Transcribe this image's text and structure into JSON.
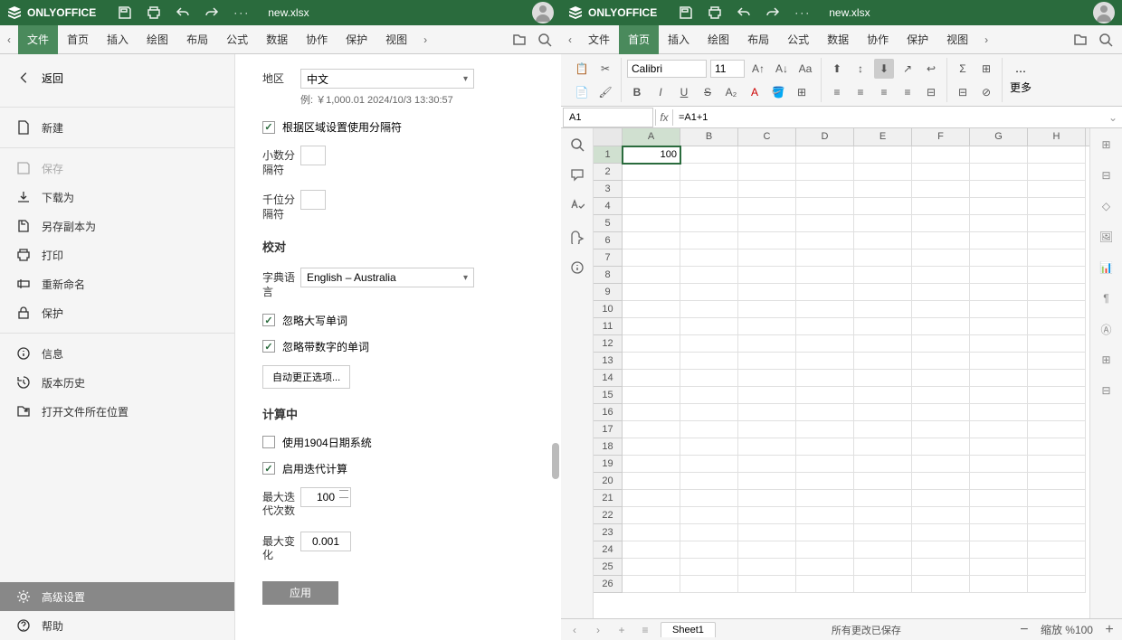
{
  "titlebar": {
    "logo": "ONLYOFFICE",
    "filename": "new.xlsx",
    "dots": "···"
  },
  "menus": [
    "文件",
    "首页",
    "插入",
    "绘图",
    "布局",
    "公式",
    "数据",
    "协作",
    "保护",
    "视图"
  ],
  "file_sidebar": {
    "back": "返回",
    "new": "新建",
    "save": "保存",
    "download": "下载为",
    "saveas": "另存副本为",
    "print": "打印",
    "rename": "重新命名",
    "protect": "保护",
    "info": "信息",
    "history": "版本历史",
    "location": "打开文件所在位置",
    "advanced": "高级设置",
    "help": "帮助"
  },
  "settings": {
    "region_label": "地区",
    "region_value": "中文",
    "example": "例: ￥1,000.01 2024/10/3 13:30:57",
    "use_separator": "根据区域设置使用分隔符",
    "decimal_label": "小数分隔符",
    "thousands_label": "千位分隔符",
    "proofing_title": "校对",
    "dict_label": "字典语言",
    "dict_value": "English – Australia",
    "ignore_upper": "忽略大写单词",
    "ignore_digits": "忽略带数字的单词",
    "autocorrect": "自动更正选项...",
    "calc_title": "计算中",
    "use_1904": "使用1904日期系统",
    "enable_iter": "启用迭代计算",
    "max_iter_label": "最大迭代次数",
    "max_iter_value": "100",
    "max_change_label": "最大变化",
    "max_change_value": "0.001",
    "apply": "应用"
  },
  "toolbar": {
    "font_name": "Calibri",
    "font_size": "11",
    "more": "更多"
  },
  "formula": {
    "cell_ref": "A1",
    "fx": "fx",
    "value": "=A1+1"
  },
  "grid": {
    "cols": [
      "A",
      "B",
      "C",
      "D",
      "E",
      "F",
      "G",
      "H"
    ],
    "rows": 26,
    "a1_value": "100"
  },
  "statusbar": {
    "sheet": "Sheet1",
    "status": "所有更改已保存",
    "zoom_label": "缩放 %",
    "zoom_value": "100"
  }
}
